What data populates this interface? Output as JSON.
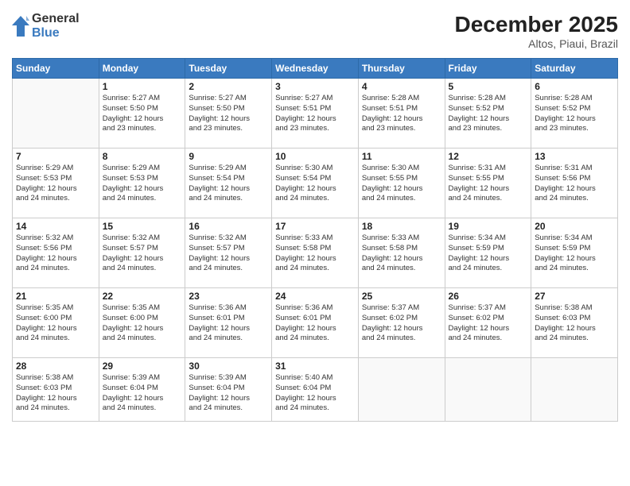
{
  "logo": {
    "general": "General",
    "blue": "Blue"
  },
  "title": {
    "month_year": "December 2025",
    "location": "Altos, Piaui, Brazil"
  },
  "weekdays": [
    "Sunday",
    "Monday",
    "Tuesday",
    "Wednesday",
    "Thursday",
    "Friday",
    "Saturday"
  ],
  "weeks": [
    [
      {
        "day": "",
        "info": ""
      },
      {
        "day": "1",
        "info": "Sunrise: 5:27 AM\nSunset: 5:50 PM\nDaylight: 12 hours\nand 23 minutes."
      },
      {
        "day": "2",
        "info": "Sunrise: 5:27 AM\nSunset: 5:50 PM\nDaylight: 12 hours\nand 23 minutes."
      },
      {
        "day": "3",
        "info": "Sunrise: 5:27 AM\nSunset: 5:51 PM\nDaylight: 12 hours\nand 23 minutes."
      },
      {
        "day": "4",
        "info": "Sunrise: 5:28 AM\nSunset: 5:51 PM\nDaylight: 12 hours\nand 23 minutes."
      },
      {
        "day": "5",
        "info": "Sunrise: 5:28 AM\nSunset: 5:52 PM\nDaylight: 12 hours\nand 23 minutes."
      },
      {
        "day": "6",
        "info": "Sunrise: 5:28 AM\nSunset: 5:52 PM\nDaylight: 12 hours\nand 23 minutes."
      }
    ],
    [
      {
        "day": "7",
        "info": "Sunrise: 5:29 AM\nSunset: 5:53 PM\nDaylight: 12 hours\nand 24 minutes."
      },
      {
        "day": "8",
        "info": "Sunrise: 5:29 AM\nSunset: 5:53 PM\nDaylight: 12 hours\nand 24 minutes."
      },
      {
        "day": "9",
        "info": "Sunrise: 5:29 AM\nSunset: 5:54 PM\nDaylight: 12 hours\nand 24 minutes."
      },
      {
        "day": "10",
        "info": "Sunrise: 5:30 AM\nSunset: 5:54 PM\nDaylight: 12 hours\nand 24 minutes."
      },
      {
        "day": "11",
        "info": "Sunrise: 5:30 AM\nSunset: 5:55 PM\nDaylight: 12 hours\nand 24 minutes."
      },
      {
        "day": "12",
        "info": "Sunrise: 5:31 AM\nSunset: 5:55 PM\nDaylight: 12 hours\nand 24 minutes."
      },
      {
        "day": "13",
        "info": "Sunrise: 5:31 AM\nSunset: 5:56 PM\nDaylight: 12 hours\nand 24 minutes."
      }
    ],
    [
      {
        "day": "14",
        "info": "Sunrise: 5:32 AM\nSunset: 5:56 PM\nDaylight: 12 hours\nand 24 minutes."
      },
      {
        "day": "15",
        "info": "Sunrise: 5:32 AM\nSunset: 5:57 PM\nDaylight: 12 hours\nand 24 minutes."
      },
      {
        "day": "16",
        "info": "Sunrise: 5:32 AM\nSunset: 5:57 PM\nDaylight: 12 hours\nand 24 minutes."
      },
      {
        "day": "17",
        "info": "Sunrise: 5:33 AM\nSunset: 5:58 PM\nDaylight: 12 hours\nand 24 minutes."
      },
      {
        "day": "18",
        "info": "Sunrise: 5:33 AM\nSunset: 5:58 PM\nDaylight: 12 hours\nand 24 minutes."
      },
      {
        "day": "19",
        "info": "Sunrise: 5:34 AM\nSunset: 5:59 PM\nDaylight: 12 hours\nand 24 minutes."
      },
      {
        "day": "20",
        "info": "Sunrise: 5:34 AM\nSunset: 5:59 PM\nDaylight: 12 hours\nand 24 minutes."
      }
    ],
    [
      {
        "day": "21",
        "info": "Sunrise: 5:35 AM\nSunset: 6:00 PM\nDaylight: 12 hours\nand 24 minutes."
      },
      {
        "day": "22",
        "info": "Sunrise: 5:35 AM\nSunset: 6:00 PM\nDaylight: 12 hours\nand 24 minutes."
      },
      {
        "day": "23",
        "info": "Sunrise: 5:36 AM\nSunset: 6:01 PM\nDaylight: 12 hours\nand 24 minutes."
      },
      {
        "day": "24",
        "info": "Sunrise: 5:36 AM\nSunset: 6:01 PM\nDaylight: 12 hours\nand 24 minutes."
      },
      {
        "day": "25",
        "info": "Sunrise: 5:37 AM\nSunset: 6:02 PM\nDaylight: 12 hours\nand 24 minutes."
      },
      {
        "day": "26",
        "info": "Sunrise: 5:37 AM\nSunset: 6:02 PM\nDaylight: 12 hours\nand 24 minutes."
      },
      {
        "day": "27",
        "info": "Sunrise: 5:38 AM\nSunset: 6:03 PM\nDaylight: 12 hours\nand 24 minutes."
      }
    ],
    [
      {
        "day": "28",
        "info": "Sunrise: 5:38 AM\nSunset: 6:03 PM\nDaylight: 12 hours\nand 24 minutes."
      },
      {
        "day": "29",
        "info": "Sunrise: 5:39 AM\nSunset: 6:04 PM\nDaylight: 12 hours\nand 24 minutes."
      },
      {
        "day": "30",
        "info": "Sunrise: 5:39 AM\nSunset: 6:04 PM\nDaylight: 12 hours\nand 24 minutes."
      },
      {
        "day": "31",
        "info": "Sunrise: 5:40 AM\nSunset: 6:04 PM\nDaylight: 12 hours\nand 24 minutes."
      },
      {
        "day": "",
        "info": ""
      },
      {
        "day": "",
        "info": ""
      },
      {
        "day": "",
        "info": ""
      }
    ]
  ]
}
